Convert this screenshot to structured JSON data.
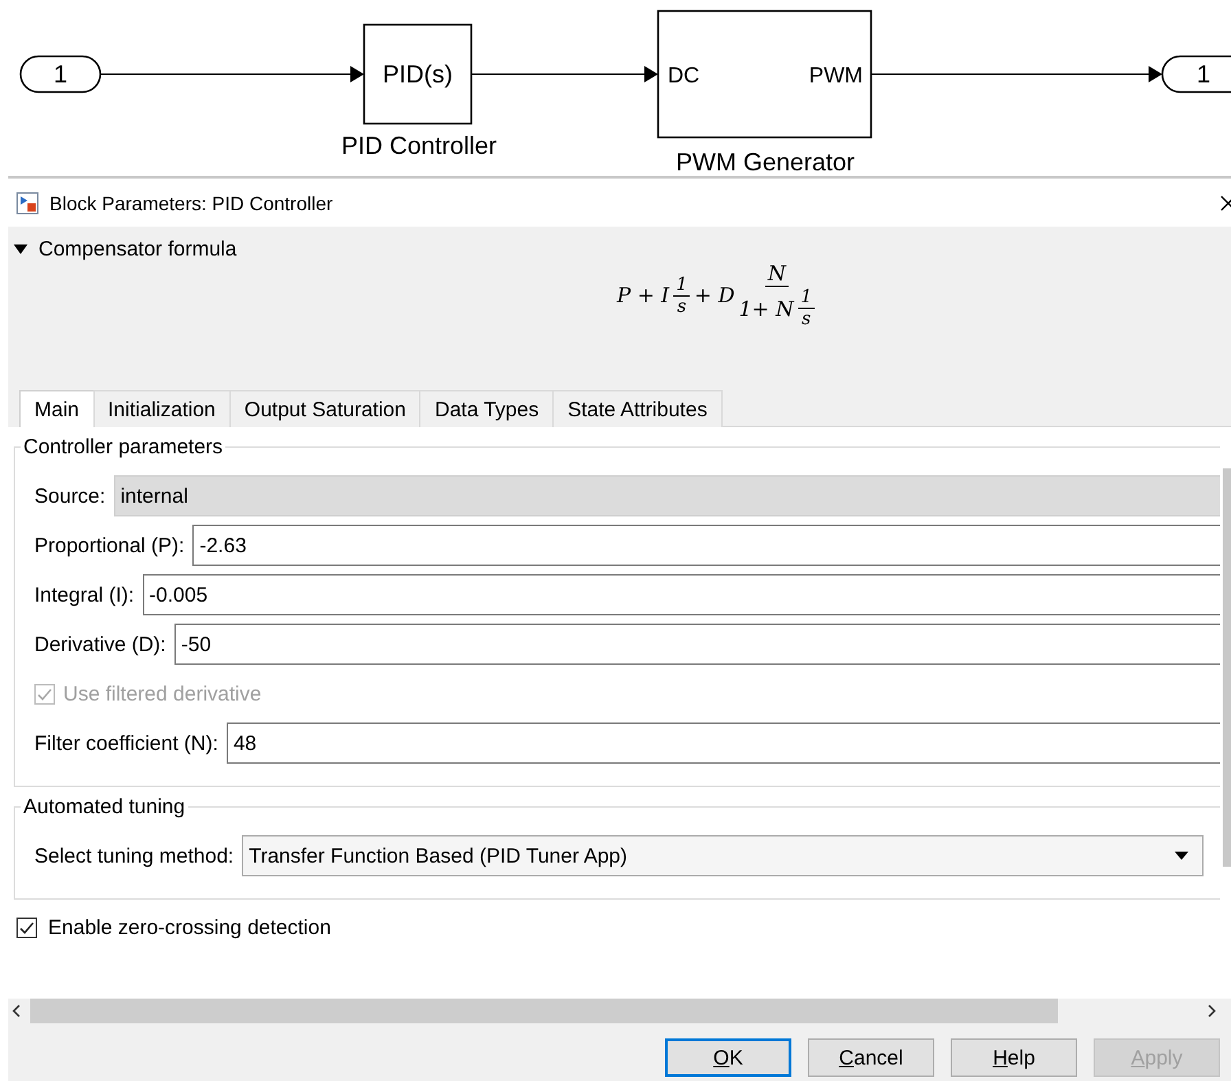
{
  "diagram": {
    "inport": "1",
    "pid": {
      "text": "PID(s)",
      "label": "PID Controller"
    },
    "pwm": {
      "ports": [
        "DC",
        "PWM"
      ],
      "label": "PWM Generator"
    },
    "outport": "1"
  },
  "dialog": {
    "title": "Block Parameters: PID Controller",
    "section": {
      "title": "Compensator formula",
      "expanded": true,
      "formula": {
        "p": "P + I",
        "i_num": "1",
        "i_den": "s",
        "d": "+ D",
        "d_num": "N",
        "d_den": "1+ N",
        "d_den_num": "1",
        "d_den_den": "s"
      }
    },
    "tabs": [
      {
        "label": "Main",
        "selected": true
      },
      {
        "label": "Initialization",
        "selected": false
      },
      {
        "label": "Output Saturation",
        "selected": false
      },
      {
        "label": "Data Types",
        "selected": false
      },
      {
        "label": "State Attributes",
        "selected": false
      }
    ],
    "groups": [
      {
        "title": "Controller parameters",
        "rows": [
          {
            "kind": "readonly",
            "label": "Source:",
            "value": "internal"
          },
          {
            "kind": "text",
            "label": "Proportional (P):",
            "value": "-2.63"
          },
          {
            "kind": "text",
            "label": "Integral (I):",
            "value": "-0.005"
          },
          {
            "kind": "text",
            "label": "Derivative (D):",
            "value": "-50"
          },
          {
            "kind": "checkbox",
            "label": "Use filtered derivative",
            "checked": true,
            "disabled": true
          },
          {
            "kind": "text",
            "label": "Filter coefficient (N):",
            "value": "48"
          }
        ]
      },
      {
        "title": "Automated tuning",
        "rows": [
          {
            "kind": "select",
            "label": "Select tuning method:",
            "value": "Transfer Function Based (PID Tuner App)"
          }
        ]
      }
    ],
    "zero_crossing": {
      "label": "Enable zero-crossing detection",
      "checked": true
    },
    "buttons": [
      {
        "label": "OK",
        "default": true,
        "disabled": false
      },
      {
        "label": "Cancel",
        "default": false,
        "disabled": false
      },
      {
        "label": "Help",
        "default": false,
        "disabled": false
      },
      {
        "label": "Apply",
        "default": false,
        "disabled": true
      }
    ]
  }
}
